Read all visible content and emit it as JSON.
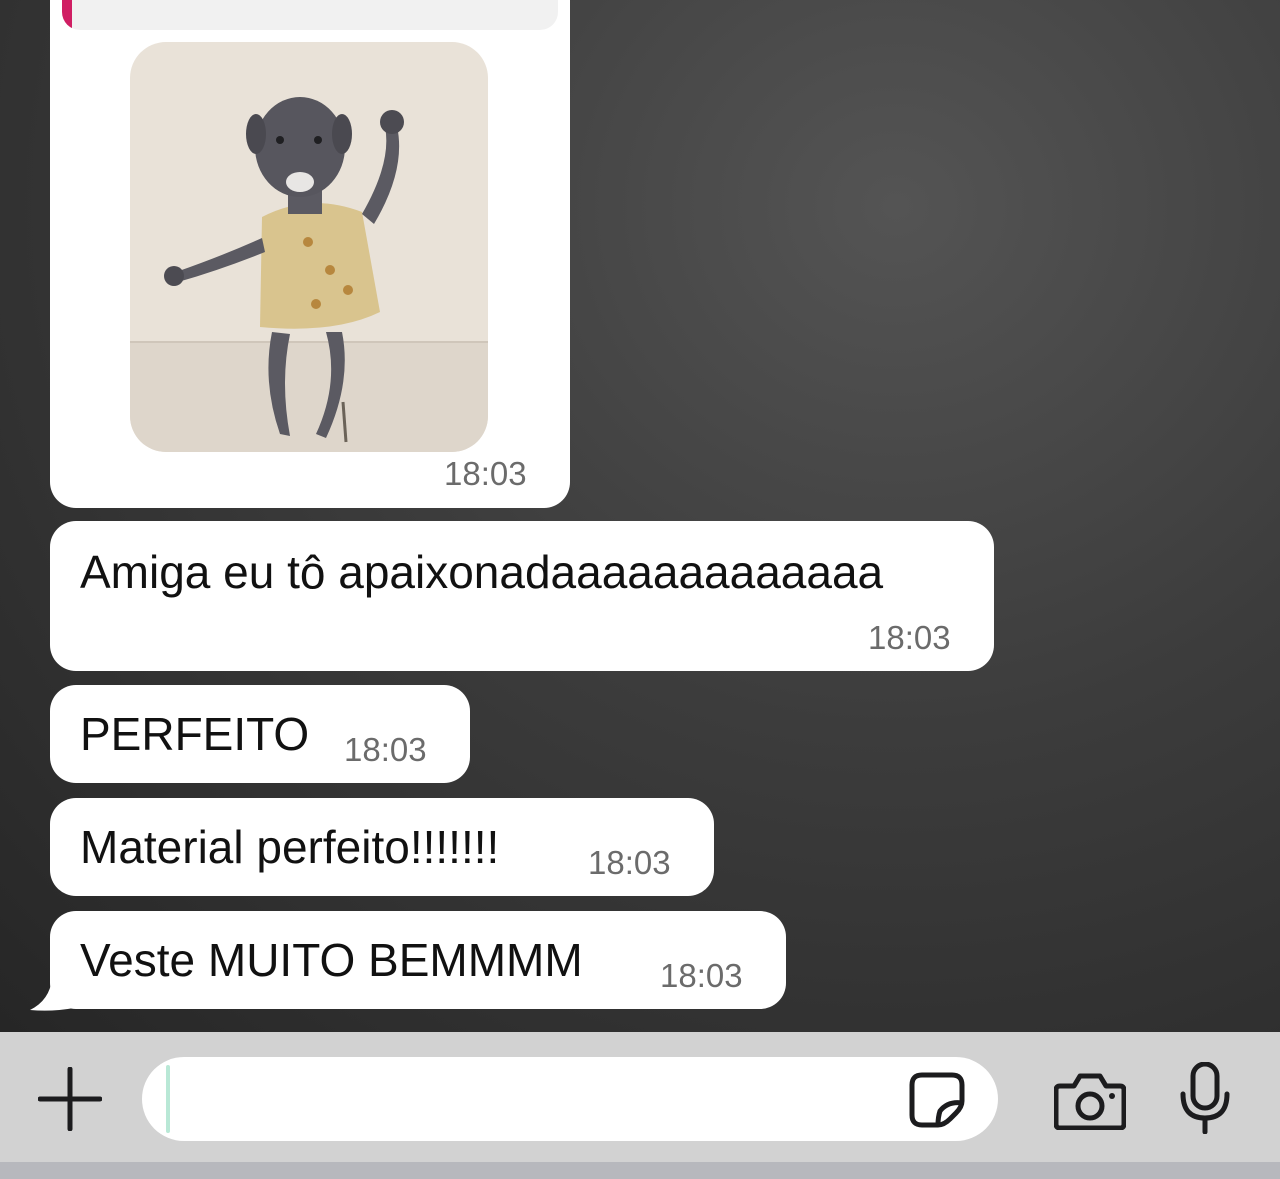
{
  "messages": [
    {
      "type": "sticker",
      "icon": "dancing-dog-sticker",
      "time": "18:03"
    },
    {
      "type": "text",
      "text": "Amiga eu tô apaixonadaaaaaaaaaaaaa",
      "time": "18:03"
    },
    {
      "type": "text",
      "text": "PERFEITO",
      "time": "18:03"
    },
    {
      "type": "text",
      "text": "Material perfeito!!!!!!!",
      "time": "18:03"
    },
    {
      "type": "text",
      "text": "Veste MUITO BEMMMM",
      "time": "18:03"
    }
  ],
  "composer": {
    "value": "",
    "icons": [
      "plus-icon",
      "sticker-icon",
      "camera-icon",
      "microphone-icon"
    ]
  },
  "colors": {
    "bubble": "#ffffff",
    "quote_accent": "#d01e63",
    "caret": "#b9e8d6",
    "input_bar": "#d2d2d2"
  }
}
